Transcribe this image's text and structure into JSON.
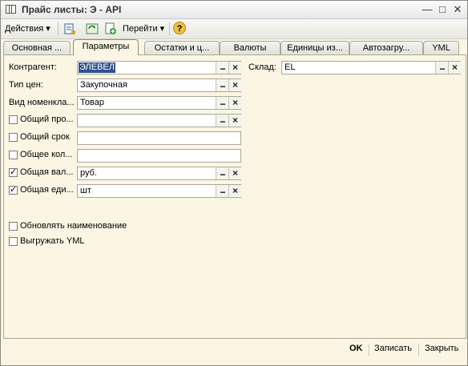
{
  "window": {
    "title": "Прайс листы: Э - API",
    "minimize_glyph": "—",
    "maximize_glyph": "□",
    "close_glyph": "✕"
  },
  "toolbar": {
    "actions_label": "Действия",
    "goto_label": "Перейти",
    "help_glyph": "?",
    "dropdown_glyph": "▾",
    "icons": [
      "new-item-icon",
      "refresh-icon",
      "add-copy-icon",
      "help-icon"
    ]
  },
  "tabs": [
    {
      "label": "Основная ...",
      "active": false
    },
    {
      "label": "Параметры",
      "active": true
    },
    {
      "label": "Остатки и ц...",
      "active": false
    },
    {
      "label": "Валюты",
      "active": false
    },
    {
      "label": "Единицы из...",
      "active": false
    },
    {
      "label": "Автозагру...",
      "active": false
    },
    {
      "label": "YML",
      "active": false
    }
  ],
  "form": {
    "kontragent": {
      "label": "Контрагент:",
      "value": "ЭЛЕВЕЛ"
    },
    "tip_cen": {
      "label": "Тип цен:",
      "value": "Закупочная"
    },
    "vid_nomenkl": {
      "label": "Вид номенкла...",
      "value": "Товар"
    },
    "obshchiy_pro": {
      "label": "Общий про...",
      "value": "",
      "checked": false
    },
    "obshchiy_srok": {
      "label": "Общий срок",
      "value": "",
      "checked": false
    },
    "obshchee_kol": {
      "label": "Общее кол...",
      "value": "",
      "checked": false
    },
    "obshchaya_val": {
      "label": "Общая вал...",
      "value": "руб.",
      "checked": true
    },
    "obshchaya_edi": {
      "label": "Общая еди...",
      "value": "шт",
      "checked": true
    },
    "sklad": {
      "label": "Склад:",
      "value": "EL"
    },
    "obnovlyat": {
      "label": "Обновлять наименование",
      "checked": false
    },
    "vygruzhat": {
      "label": "Выгружать YML",
      "checked": false
    },
    "dots_glyph": "...",
    "clear_glyph": "×",
    "check_glyph": "✓"
  },
  "footer": {
    "ok_label": "OK",
    "save_label": "Записать",
    "close_label": "Закрыть"
  }
}
